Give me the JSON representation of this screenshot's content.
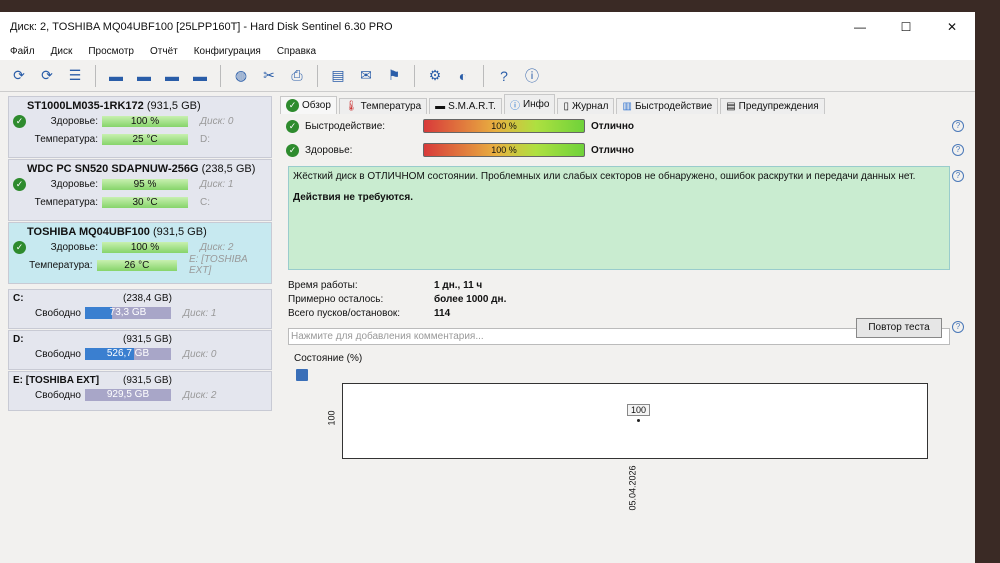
{
  "title": "Диск: 2, TOSHIBA MQ04UBF100 [25LPP160T]  -  Hard Disk Sentinel 6.30 PRO",
  "window_controls": [
    "—",
    "☐",
    "✕"
  ],
  "menu": [
    "Файл",
    "Диск",
    "Просмотр",
    "Отчёт",
    "Конфигурация",
    "Справка"
  ],
  "disks": [
    {
      "name": "ST1000LM035-1RK172",
      "size": "(931,5 GB)",
      "health_label": "Здоровье:",
      "health": "100 %",
      "temp_label": "Температура:",
      "temp": "25 °C",
      "disk": "Диск: 0",
      "vol": "D:"
    },
    {
      "name": "WDC PC SN520 SDAPNUW-256G",
      "size": "(238,5 GB)",
      "health_label": "Здоровье:",
      "health": "95 %",
      "temp_label": "Температура:",
      "temp": "30 °C",
      "disk": "Диск: 1",
      "vol": "C:"
    },
    {
      "name": "TOSHIBA MQ04UBF100",
      "size": "(931,5 GB)",
      "health_label": "Здоровье:",
      "health": "100 %",
      "temp_label": "Температура:",
      "temp": "26 °C",
      "disk": "Диск: 2",
      "vol": "E: [TOSHIBA EXT]"
    }
  ],
  "volumes": [
    {
      "name": "C:",
      "size": "(238,4 GB)",
      "free_label": "Свободно",
      "free": "73,3 GB",
      "free_pct": 31,
      "disk": "Диск: 1"
    },
    {
      "name": "D:",
      "size": "(931,5 GB)",
      "free_label": "Свободно",
      "free": "526,7 GB",
      "free_pct": 57,
      "disk": "Диск: 0"
    },
    {
      "name": "E: [TOSHIBA EXT]",
      "size": "(931,5 GB)",
      "free_label": "Свободно",
      "free": "929,5 GB",
      "free_pct": 0,
      "disk": "Диск: 2"
    }
  ],
  "tabs": [
    "Обзор",
    "Температура",
    "S.M.A.R.T.",
    "Инфо",
    "Журнал",
    "Быстродействие",
    "Предупреждения"
  ],
  "overview": {
    "perf_label": "Быстродействие:",
    "perf": "100 %",
    "perf_rating": "Отлично",
    "health_label": "Здоровье:",
    "health": "100 %",
    "health_rating": "Отлично",
    "message": "Жёсткий диск в ОТЛИЧНОМ состоянии. Проблемных или слабых секторов не обнаружено, ошибок раскрутки и передачи данных нет.",
    "action": "Действия не требуются.",
    "uptime_label": "Время работы:",
    "uptime": "1 дн., 11 ч",
    "remaining_label": "Примерно осталось:",
    "remaining": "более 1000 дн.",
    "starts_label": "Всего пусков/остановок:",
    "starts": "114",
    "retest": "Повтор теста",
    "comment_placeholder": "Нажмите для добавления комментария..."
  },
  "chart_data": {
    "type": "line",
    "title": "Состояние (%)",
    "x": [
      "05.04.2026"
    ],
    "values": [
      100
    ],
    "ylabel_tick": "100",
    "ylim": [
      100,
      100
    ]
  }
}
